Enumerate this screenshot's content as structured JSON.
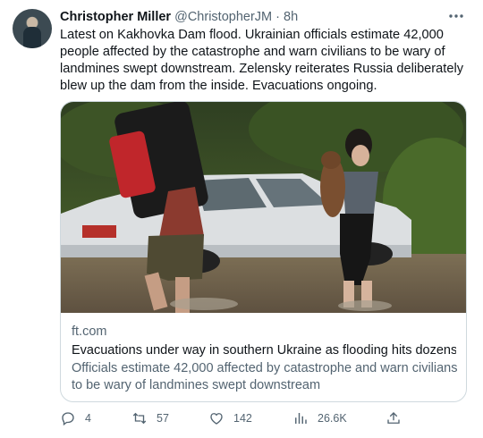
{
  "author": {
    "name": "Christopher Miller",
    "handle": "@ChristopherJM",
    "separator": "·",
    "time": "8h"
  },
  "tweet_text": "Latest on Kakhovka Dam flood. Ukrainian officials estimate 42,000 people affected by the catastrophe and warn civilians to be wary of landmines swept downstream. Zelensky reiterates Russia deliberately blew up the dam from the inside. Evacuations ongoing.",
  "card": {
    "domain": "ft.com",
    "title": "Evacuations under way in southern Ukraine as flooding hits dozens ...",
    "description": "Officials estimate 42,000 affected by catastrophe and warn civilians to be wary of landmines swept downstream"
  },
  "actions": {
    "replies": "4",
    "retweets": "57",
    "likes": "142",
    "views": "26.6K"
  },
  "icons": {
    "more": "more-icon",
    "reply": "reply-icon",
    "retweet": "retweet-icon",
    "like": "heart-icon",
    "views": "views-icon",
    "share": "share-icon"
  },
  "colors": {
    "text": "#0f1419",
    "secondary": "#536471",
    "border": "#cfd9de",
    "background": "#ffffff"
  }
}
